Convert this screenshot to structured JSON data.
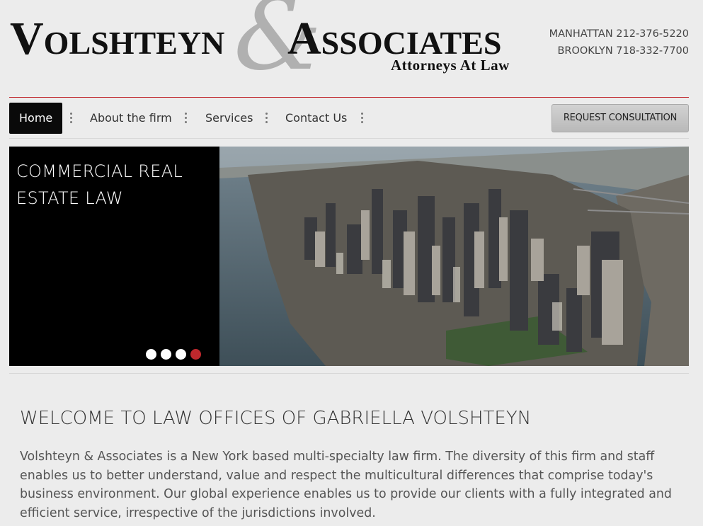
{
  "header": {
    "logo_left": "Volshteyn",
    "logo_ampersand": "&",
    "logo_right": "Associates",
    "logo_tagline": "Attorneys At Law",
    "phone_manhattan": "MANHATTAN 212-376-5220",
    "phone_brooklyn": "BROOKLYN 718-332-7700"
  },
  "nav": {
    "items": [
      {
        "label": "Home"
      },
      {
        "label": "About the firm"
      },
      {
        "label": "Services"
      },
      {
        "label": "Contact Us"
      }
    ],
    "consult_label": "REQUEST CONSULTATION"
  },
  "slider": {
    "caption": "COMMERCIAL REAL ESTATE LAW",
    "dots_total": 4,
    "active_dot": 4
  },
  "content": {
    "heading": "WELCOME TO LAW OFFICES OF GABRIELLA VOLSHTEYN",
    "body": "Volshteyn & Associates is a New York based multi-specialty law firm.  The diversity of this firm and staff enables us to better understand, value and respect the multicultural differences that comprise today's business environment. Our global experience enables us to provide our clients with a fully integrated and efficient service, irrespective of the jurisdictions involved."
  },
  "colors": {
    "accent_red": "#c0282d",
    "nav_active_bg": "#0a0a0a",
    "page_bg": "#ececec"
  }
}
